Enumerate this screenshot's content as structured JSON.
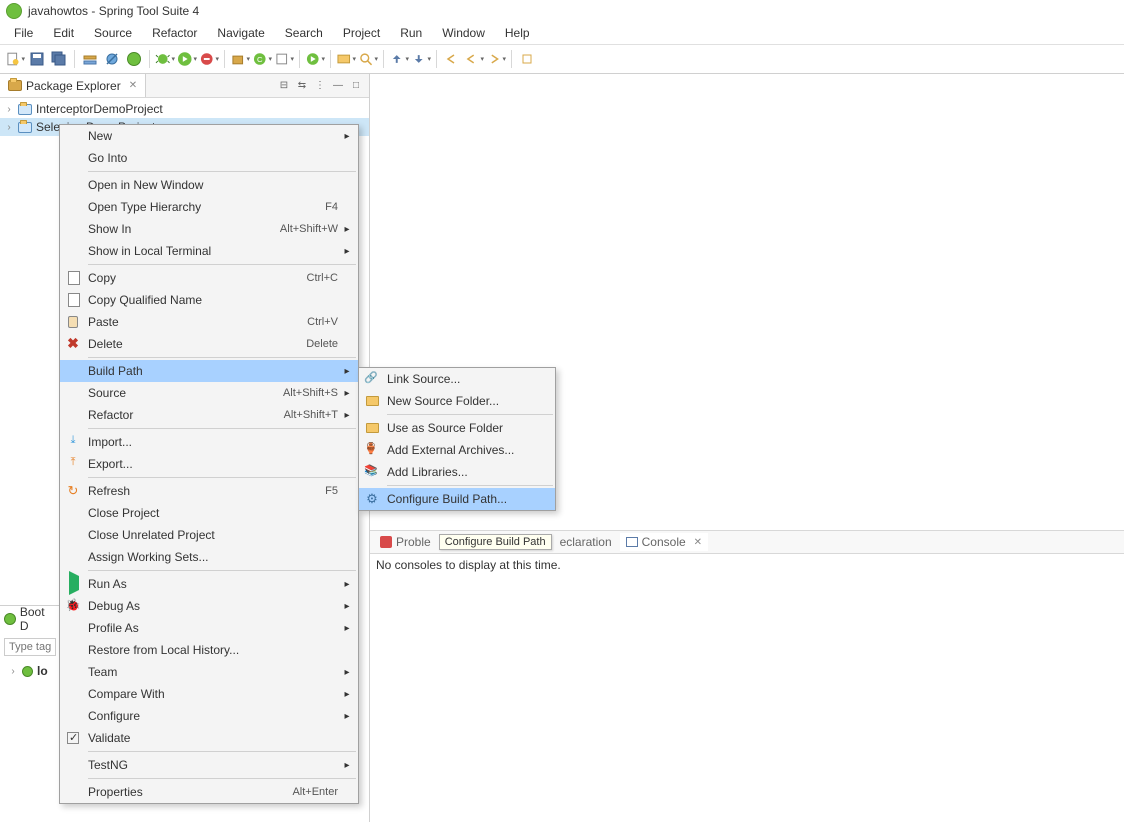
{
  "title": "javahowtos - Spring Tool Suite 4",
  "menubar": [
    "File",
    "Edit",
    "Source",
    "Refactor",
    "Navigate",
    "Search",
    "Project",
    "Run",
    "Window",
    "Help"
  ],
  "package_explorer": {
    "title": "Package Explorer",
    "items": [
      {
        "label": "InterceptorDemoProject"
      },
      {
        "label": "SeleniumDemoProject"
      }
    ]
  },
  "boot_dash": {
    "title": "Boot D",
    "filter_placeholder": "Type tag",
    "item": "lo"
  },
  "context_menu": [
    {
      "type": "item",
      "label": "New",
      "arrow": true
    },
    {
      "type": "item",
      "label": "Go Into"
    },
    {
      "type": "sep"
    },
    {
      "type": "item",
      "label": "Open in New Window"
    },
    {
      "type": "item",
      "label": "Open Type Hierarchy",
      "shortcut": "F4"
    },
    {
      "type": "item",
      "label": "Show In",
      "shortcut": "Alt+Shift+W",
      "arrow": true
    },
    {
      "type": "item",
      "label": "Show in Local Terminal",
      "arrow": true
    },
    {
      "type": "sep"
    },
    {
      "type": "item",
      "label": "Copy",
      "shortcut": "Ctrl+C",
      "icon": "copy"
    },
    {
      "type": "item",
      "label": "Copy Qualified Name",
      "icon": "copy"
    },
    {
      "type": "item",
      "label": "Paste",
      "shortcut": "Ctrl+V",
      "icon": "paste"
    },
    {
      "type": "item",
      "label": "Delete",
      "shortcut": "Delete",
      "icon": "delete"
    },
    {
      "type": "sep"
    },
    {
      "type": "item",
      "label": "Build Path",
      "arrow": true,
      "highlighted": true
    },
    {
      "type": "item",
      "label": "Source",
      "shortcut": "Alt+Shift+S",
      "arrow": true
    },
    {
      "type": "item",
      "label": "Refactor",
      "shortcut": "Alt+Shift+T",
      "arrow": true
    },
    {
      "type": "sep"
    },
    {
      "type": "item",
      "label": "Import...",
      "icon": "import"
    },
    {
      "type": "item",
      "label": "Export...",
      "icon": "export"
    },
    {
      "type": "sep"
    },
    {
      "type": "item",
      "label": "Refresh",
      "shortcut": "F5",
      "icon": "refresh"
    },
    {
      "type": "item",
      "label": "Close Project"
    },
    {
      "type": "item",
      "label": "Close Unrelated Project"
    },
    {
      "type": "item",
      "label": "Assign Working Sets..."
    },
    {
      "type": "sep"
    },
    {
      "type": "item",
      "label": "Run As",
      "arrow": true,
      "icon": "run"
    },
    {
      "type": "item",
      "label": "Debug As",
      "arrow": true,
      "icon": "debug"
    },
    {
      "type": "item",
      "label": "Profile As",
      "arrow": true
    },
    {
      "type": "item",
      "label": "Restore from Local History..."
    },
    {
      "type": "item",
      "label": "Team",
      "arrow": true
    },
    {
      "type": "item",
      "label": "Compare With",
      "arrow": true
    },
    {
      "type": "item",
      "label": "Configure",
      "arrow": true
    },
    {
      "type": "item",
      "label": "Validate",
      "icon": "check"
    },
    {
      "type": "sep"
    },
    {
      "type": "item",
      "label": "TestNG",
      "arrow": true
    },
    {
      "type": "sep"
    },
    {
      "type": "item",
      "label": "Properties",
      "shortcut": "Alt+Enter"
    }
  ],
  "sub_menu": [
    {
      "label": "Link Source...",
      "icon": "link-source"
    },
    {
      "label": "New Source Folder...",
      "icon": "generic-folder"
    },
    {
      "type": "sep"
    },
    {
      "label": "Use as Source Folder",
      "icon": "generic-folder"
    },
    {
      "label": "Add External Archives...",
      "icon": "jar"
    },
    {
      "label": "Add Libraries...",
      "icon": "lib"
    },
    {
      "type": "sep"
    },
    {
      "label": "Configure Build Path...",
      "icon": "gear",
      "highlighted": true
    }
  ],
  "tooltip_text": "Configure Build Path",
  "bottom_tabs": {
    "problems": "Proble",
    "declaration": "eclaration",
    "console": "Console"
  },
  "console_message": "No consoles to display at this time."
}
